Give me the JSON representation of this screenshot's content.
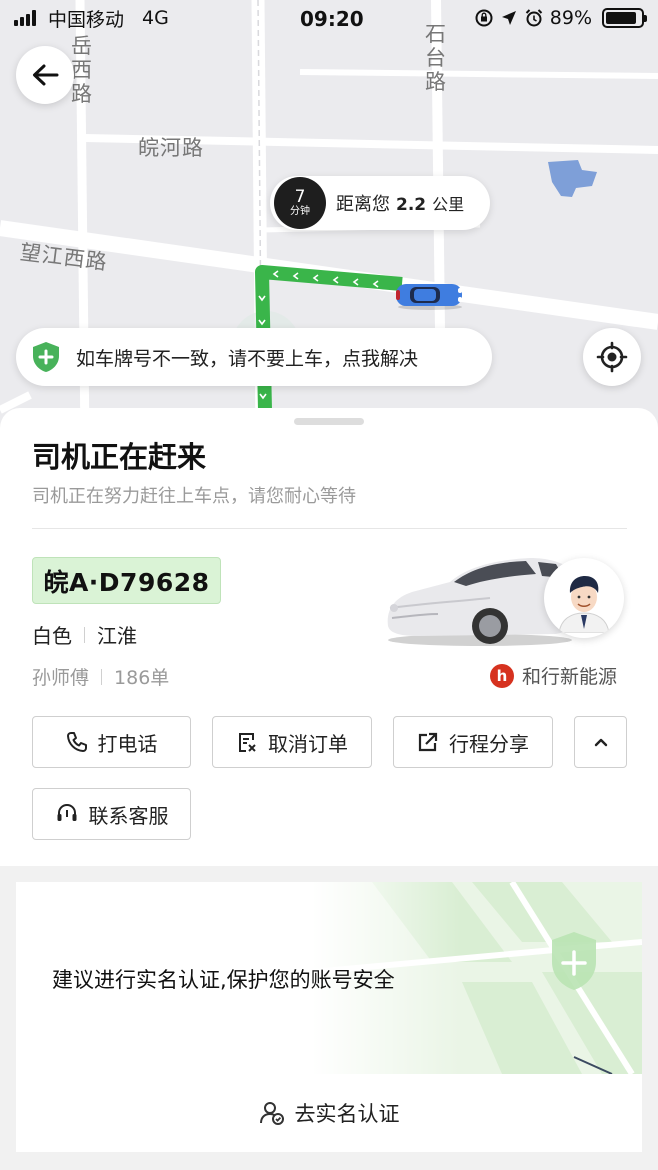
{
  "status_bar": {
    "carrier": "中国移动",
    "network": "4G",
    "time": "09:20",
    "battery": "89%",
    "battery_level": 0.89
  },
  "map": {
    "road_labels": {
      "yuexi": "岳西路",
      "shitai": "石台路",
      "wanhe": "皖河路",
      "wangjiangxi": "望江西路"
    },
    "eta": {
      "minutes": "7",
      "minutes_unit": "分钟",
      "distance_prefix": "距离您",
      "distance_value": "2.2",
      "distance_unit": "公里"
    },
    "notice": "如车牌号不一致，请不要上车，点我解决",
    "colors": {
      "route": "#3ab54a",
      "car": "#3f7de0",
      "map_bg": "#ebebee"
    }
  },
  "panel": {
    "title": "司机正在赶来",
    "subtitle": "司机正在努力赶往上车点，请您耐心等待",
    "plate": "皖A·D79628",
    "car_color": "白色",
    "car_brand": "江淮",
    "driver_name": "孙师傅",
    "driver_orders": "186单",
    "company": "和行新能源",
    "company_logo_letter": "h",
    "buttons": {
      "call": "打电话",
      "cancel": "取消订单",
      "share": "行程分享",
      "service": "联系客服"
    }
  },
  "auth": {
    "text": "建议进行实名认证,保护您的账号安全",
    "action": "去实名认证"
  }
}
